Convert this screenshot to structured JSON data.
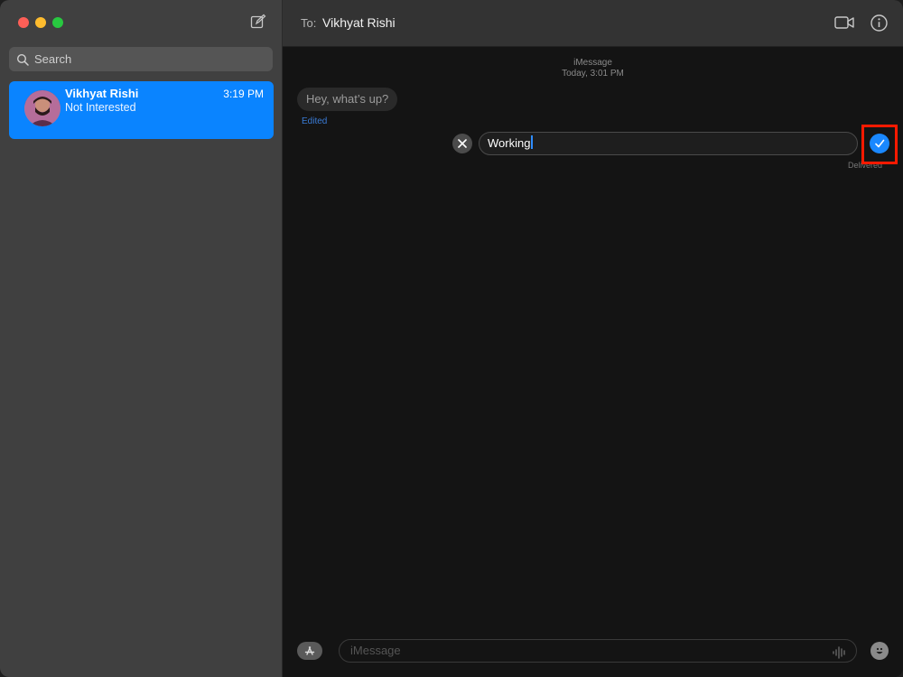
{
  "sidebar": {
    "search_placeholder": "Search",
    "conversations": [
      {
        "name": "Vikhyat Rishi",
        "time": "3:19 PM",
        "preview": "Not Interested"
      }
    ]
  },
  "header": {
    "to_label": "To:",
    "recipient": "Vikhyat Rishi"
  },
  "thread": {
    "service": "iMessage",
    "timestamp": "Today, 3:01 PM",
    "incoming_message": "Hey, what’s up?",
    "edited_label": "Edited",
    "edit_field_value": "Working",
    "delivered_label": "Delivered"
  },
  "composer": {
    "placeholder": "iMessage"
  },
  "colors": {
    "accent": "#0a84ff",
    "highlight": "#ff1a00",
    "traffic_red": "#fe5f57",
    "traffic_yellow": "#febc2e",
    "traffic_green": "#28c840"
  },
  "icons": [
    "compose-icon",
    "search-icon",
    "video-icon",
    "info-icon",
    "close-icon",
    "checkmark-icon",
    "app-store-icon",
    "audio-waveform-icon",
    "emoji-icon"
  ]
}
